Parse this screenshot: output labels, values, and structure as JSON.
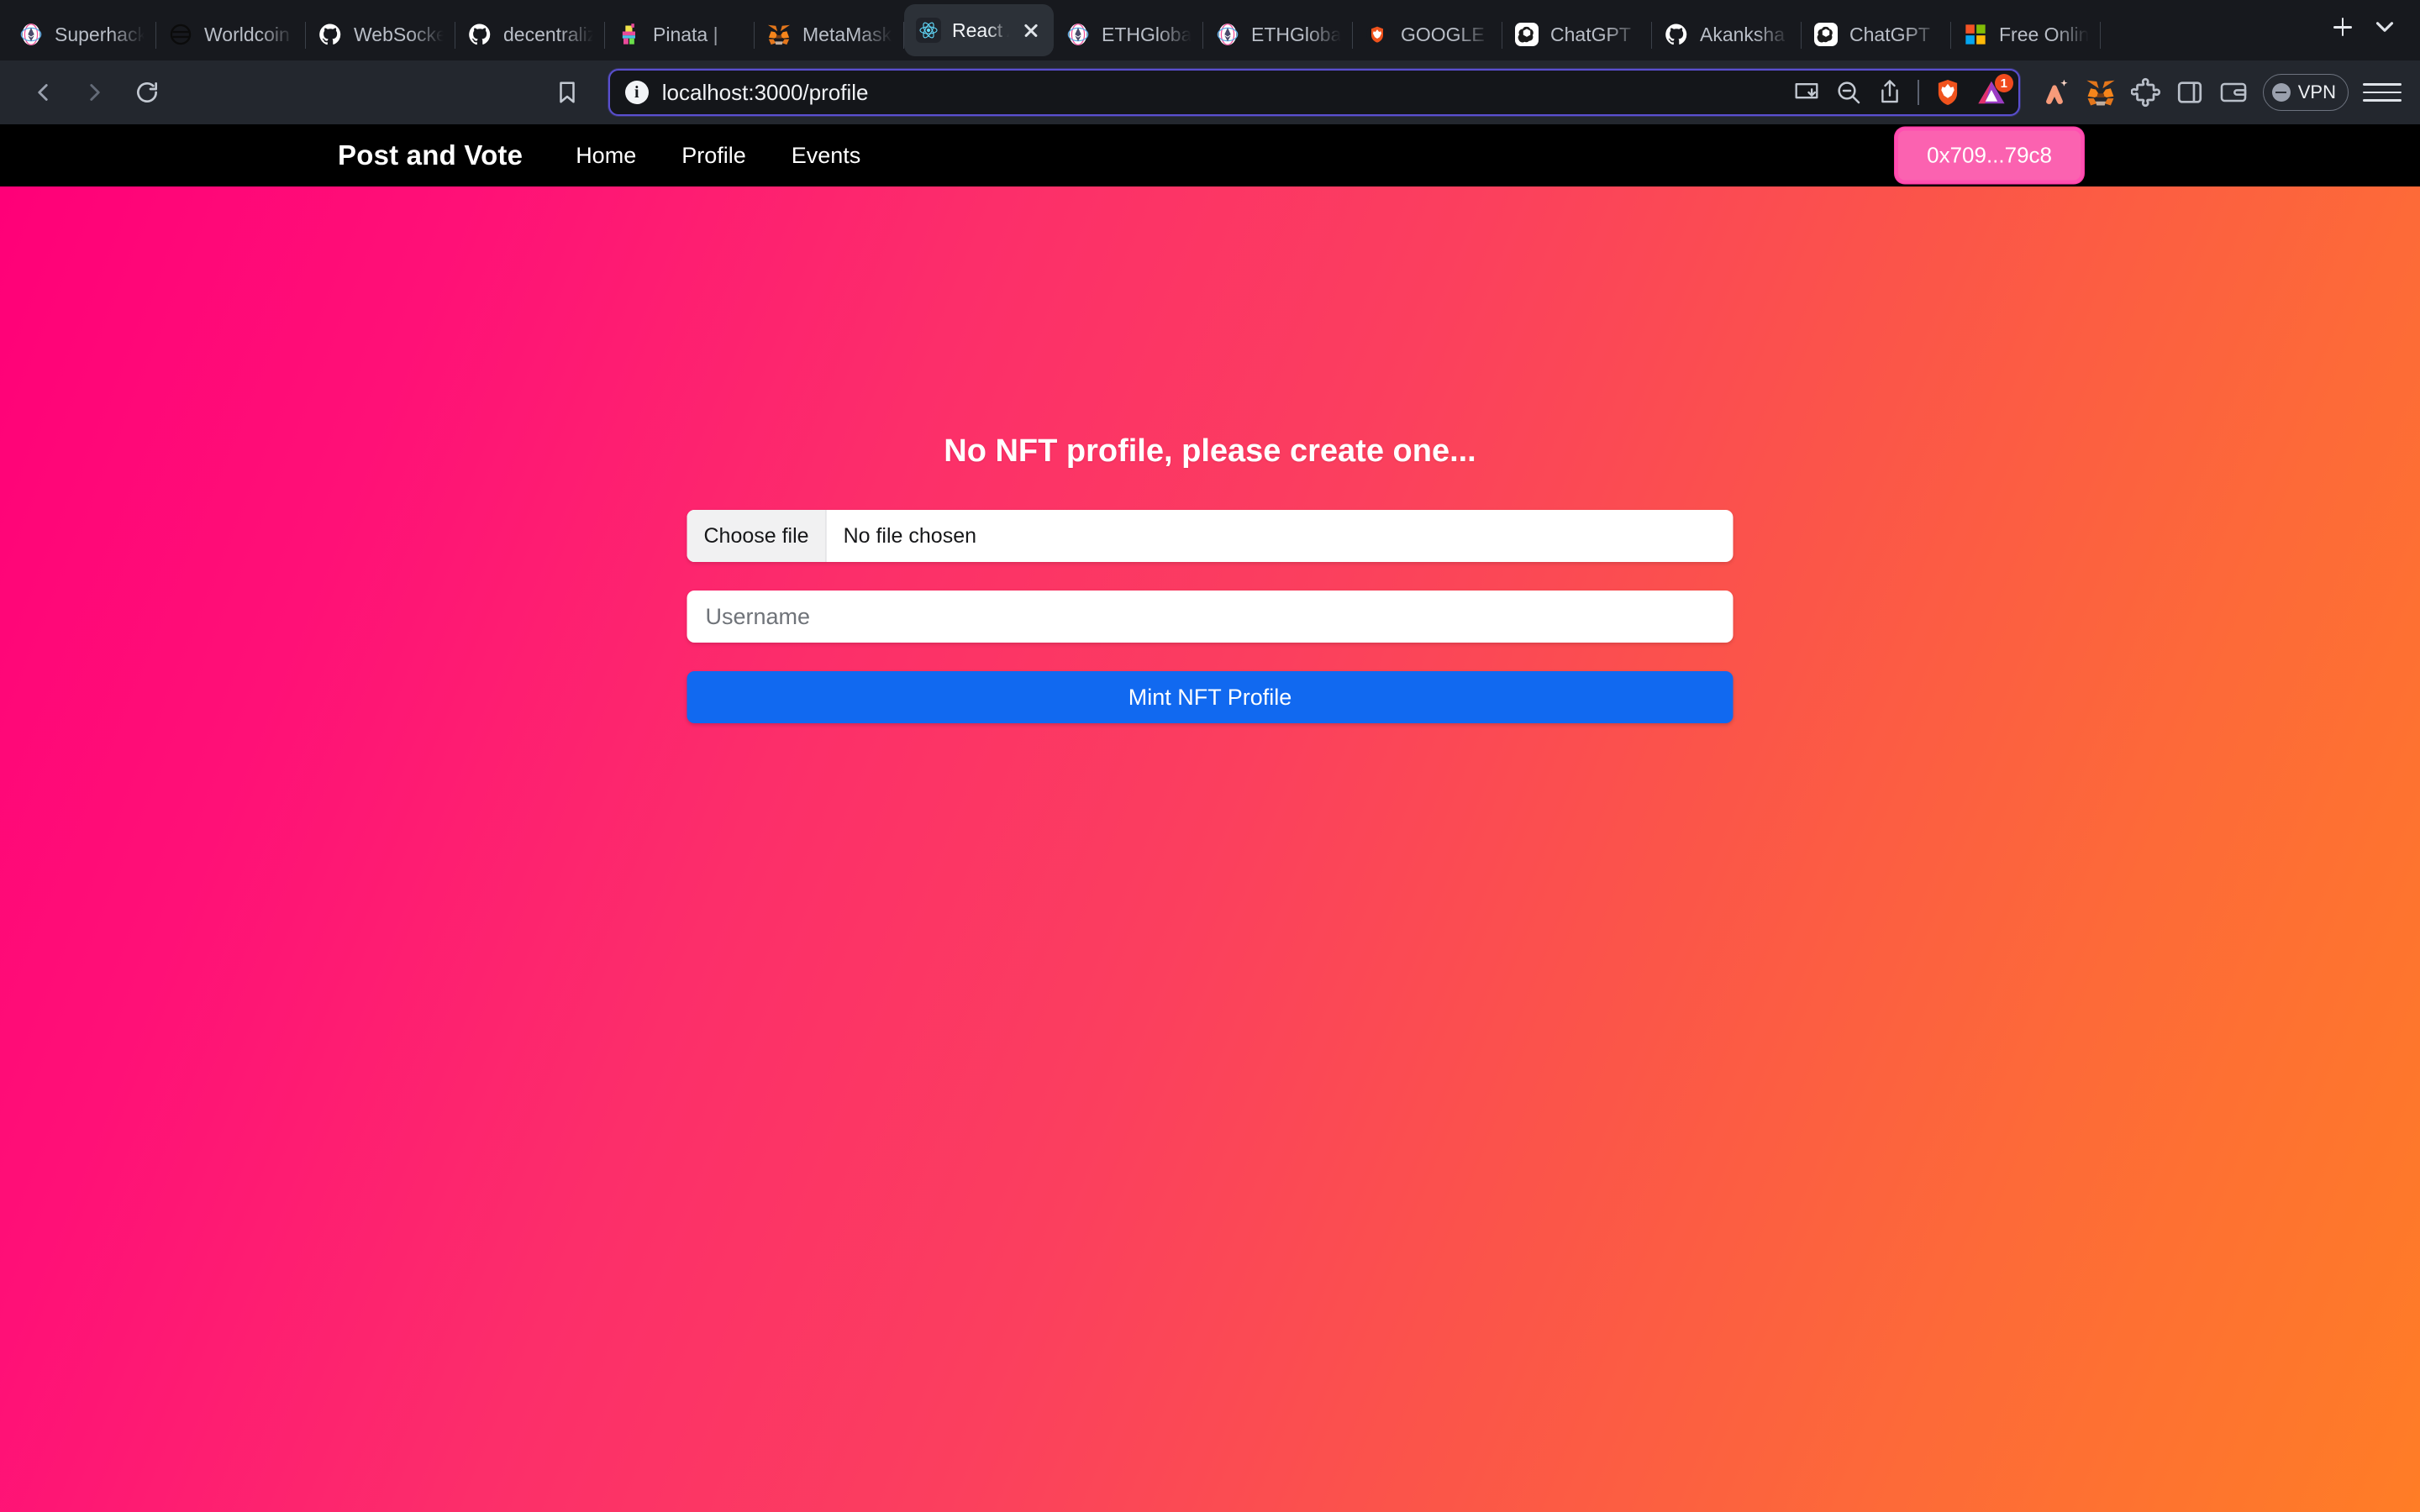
{
  "browser": {
    "tabs": [
      {
        "title": "Superhack",
        "favicon": "ethglobal-icon",
        "active": false
      },
      {
        "title": "Worldcoin",
        "favicon": "worldcoin-icon",
        "active": false
      },
      {
        "title": "WebSocket",
        "favicon": "github-icon",
        "active": false
      },
      {
        "title": "decentralized",
        "favicon": "github-icon",
        "active": false
      },
      {
        "title": "Pinata | ",
        "favicon": "pinata-icon",
        "active": false
      },
      {
        "title": "MetaMask",
        "favicon": "metamask-icon",
        "active": false
      },
      {
        "title": "React App",
        "favicon": "react-icon",
        "active": true
      },
      {
        "title": "ETHGlobal",
        "favicon": "ethglobal-icon",
        "active": false
      },
      {
        "title": "ETHGlobal",
        "favicon": "ethglobal-icon",
        "active": false
      },
      {
        "title": "GOOGLE",
        "favicon": "brave-icon",
        "active": false
      },
      {
        "title": "ChatGPT",
        "favicon": "openai-icon",
        "active": false
      },
      {
        "title": "Akanksha",
        "favicon": "github-icon",
        "active": false
      },
      {
        "title": "ChatGPT",
        "favicon": "openai-icon",
        "active": false
      },
      {
        "title": "Free Online",
        "favicon": "microsoft-icon",
        "active": false
      }
    ],
    "new_tab_label": "+",
    "address": {
      "url": "localhost:3000/profile",
      "security_icon": "info-icon"
    },
    "nav": {
      "back_icon": "back-arrow-icon",
      "forward_icon": "forward-arrow-icon",
      "reload_icon": "reload-icon",
      "bookmark_icon": "bookmark-icon"
    },
    "url_actions": {
      "install_icon": "install-app-icon",
      "zoom_icon": "zoom-out-icon",
      "share_icon": "share-icon",
      "shields_icon": "brave-shields-icon",
      "rewards_icon": "brave-rewards-icon",
      "rewards_badge": "1"
    },
    "toolbar": {
      "leo_icon": "leo-ai-icon",
      "metamask_icon": "metamask-extension-icon",
      "extensions_icon": "extensions-puzzle-icon",
      "sidebar_icon": "sidebar-panel-icon",
      "wallet_icon": "brave-wallet-icon",
      "vpn_label": "VPN",
      "vpn_icon": "vpn-shield-icon",
      "menu_icon": "hamburger-menu-icon"
    }
  },
  "site": {
    "brand": "Post and Vote",
    "nav_links": [
      {
        "label": "Home"
      },
      {
        "label": "Profile"
      },
      {
        "label": "Events"
      }
    ],
    "wallet_address": "0x709...79c8"
  },
  "main": {
    "heading": "No NFT profile, please create one...",
    "file_input": {
      "button_label": "Choose file",
      "status": "No file chosen"
    },
    "username_input": {
      "placeholder": "Username",
      "value": ""
    },
    "mint_button": "Mint NFT Profile"
  },
  "colors": {
    "gradient_start": "#ff0078",
    "gradient_mid": "#fb3f5e",
    "gradient_end": "#ff7d26",
    "navbar_bg": "#000000",
    "wallet_pink": "#fb62b0",
    "mint_blue": "#1169f0",
    "chrome_bg": "#23272e",
    "tabstrip_bg": "#17191e",
    "url_focus_border": "#5a4fcf"
  }
}
